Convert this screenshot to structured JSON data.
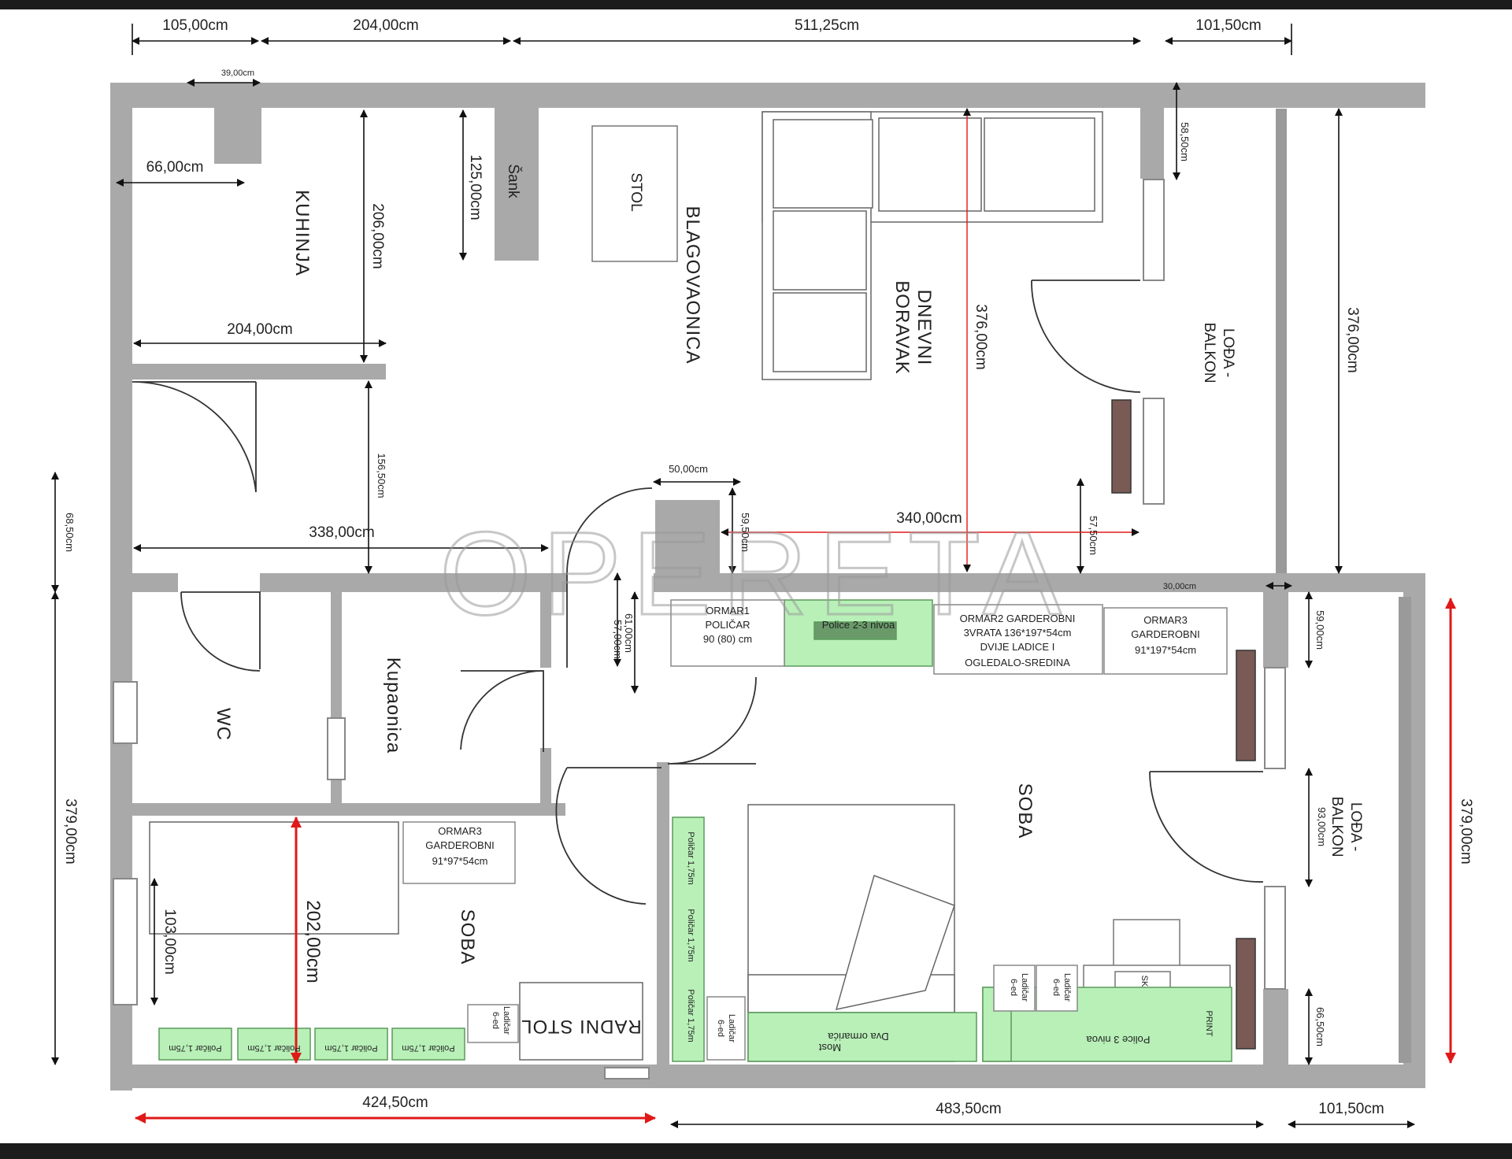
{
  "watermark": "OPERETA",
  "rooms": {
    "kuhinja": "KUHINJA",
    "sank": "Šank",
    "stol": "STOL",
    "blagovaonica": "BLAGOVAONICA",
    "dnevni_1": "DNEVNI",
    "dnevni_2": "BORAVAK",
    "loda_1_a": "LOĐA -",
    "loda_1_b": "BALKON",
    "loda_2_a": "LOĐA -",
    "loda_2_b": "BALKON",
    "wc": "WC",
    "kupaonica": "Kupaonica",
    "soba_1": "SOBA",
    "soba_2": "SOBA",
    "radni_stol": "RADNI STOL"
  },
  "furniture": {
    "ormar1": [
      "ORMAR1",
      "POLIČAR",
      "90 (80) cm"
    ],
    "police_23": "Police 2-3 nivoa",
    "ormar2": [
      "ORMAR2 GARDEROBNI",
      "3VRATA 136*197*54cm",
      "DVIJE LADICE I",
      "OGLEDALO-SREDINA"
    ],
    "ormar3_right": [
      "ORMAR3",
      "GARDEROBNI",
      "91*197*54cm"
    ],
    "ormar3_left": [
      "ORMAR3",
      "GARDEROBNI",
      "91*97*54cm"
    ],
    "policar_left": [
      "Poličar 1,75m",
      "Poličar 1,75m",
      "Poličar 1,75m",
      "Poličar 1,75m"
    ],
    "ladicar_left": [
      "Ladičar",
      "6-ed"
    ],
    "policar_vertical": [
      "Poličar 1,75m",
      "Poličar 1,75m",
      "Poličar 1,75m"
    ],
    "ladicar_bed": [
      "Ladičar",
      "6-ed"
    ],
    "dva_ormarica": "Dva ormarića",
    "most": "Most",
    "ladicar_desk_1": [
      "Ladičar",
      "6-ed"
    ],
    "ladicar_desk_2": [
      "Ladičar",
      "6-ed"
    ],
    "police_3nivoa": "Police 3 nivoa",
    "print": "PRINT",
    "sk": "SK"
  },
  "dimensions": {
    "top": [
      "105,00cm",
      "204,00cm",
      "511,25cm",
      "101,50cm"
    ],
    "d_3900": "39,00cm",
    "d_6600": "66,00cm",
    "d_12500": "125,00cm",
    "d_20600": "206,00cm",
    "d_20400": "204,00cm",
    "d_15650": "156,50cm",
    "d_33800": "338,00cm",
    "d_37600_living": "376,00cm",
    "d_37600_right": "376,00cm",
    "d_5850": "58,50cm",
    "d_5000": "50,00cm",
    "d_5950": "59,50cm",
    "d_34000": "340,00cm",
    "d_5750": "57,50cm",
    "d_3000": "30,00cm",
    "d_6100": "61,00cm",
    "d_5700": "57,00cm",
    "d_6850": "68,50cm",
    "d_37900_left": "379,00cm",
    "d_37900_right": "379,00cm",
    "d_20200": "202,00cm",
    "d_10300": "103,00cm",
    "d_5900": "59,00cm",
    "d_9300": "93,00cm",
    "d_6650": "66,50cm",
    "bottom": [
      "424,50cm",
      "483,50cm",
      "101,50cm"
    ]
  },
  "colors": {
    "wall": "#a9a9a9",
    "furniture_green": "#b8f0b8",
    "accent_red": "#e01818",
    "wood_brown": "#7a5a55"
  }
}
